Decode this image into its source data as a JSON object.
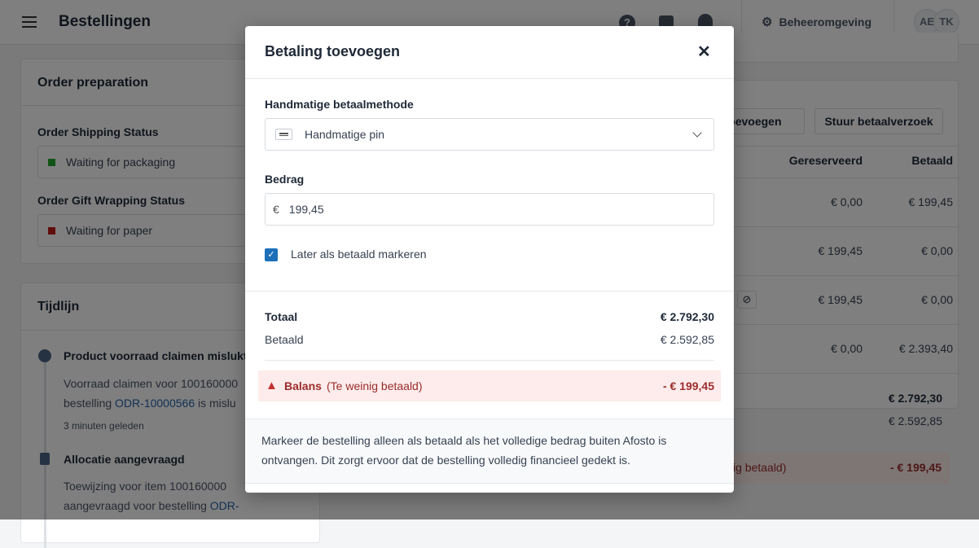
{
  "header": {
    "title": "Bestellingen",
    "admin_label": "Beheeromgeving",
    "avatars": [
      "AE",
      "TK"
    ]
  },
  "order_prep": {
    "title": "Order preparation",
    "shipping_label": "Order Shipping Status",
    "shipping_value": "Waiting for packaging",
    "shipping_color": "#22a82a",
    "gift_label": "Order Gift Wrapping Status",
    "gift_value": "Waiting for paper",
    "gift_color": "#c01818"
  },
  "timeline": {
    "title": "Tijdlijn",
    "items": [
      {
        "title": "Product voorraad claimen mislukt",
        "text1": "Voorraad claimen voor 100160000",
        "text2_pre": "bestelling ",
        "link": "ODR-10000566",
        "text2_post": " is mislu",
        "time": "3 minuten geleden"
      },
      {
        "title": "Allocatie aangevraagd",
        "text1": "Toewijzing voor item 100160000",
        "text2_pre": "aangevraagd voor bestelling ",
        "link": "ODR-"
      }
    ]
  },
  "payments": {
    "add_button": "toevoegen",
    "request_button": "Stuur betaalverzoek",
    "col_reserved": "Gereserveerd",
    "col_paid": "Betaald",
    "rows": [
      {
        "reserved": "€ 0,00",
        "paid": "€ 199,45"
      },
      {
        "reserved": "€ 199,45",
        "paid": "€ 0,00"
      },
      {
        "reserved": "€ 199,45",
        "paid": "€ 0,00"
      },
      {
        "reserved": "€ 0,00",
        "paid": "€ 2.393,40"
      }
    ],
    "total": "€ 2.792,30",
    "paid_total": "€ 2.592,85",
    "balance_note": "ig betaald)",
    "balance": "- € 199,45"
  },
  "modal": {
    "title": "Betaling toevoegen",
    "method_label": "Handmatige betaalmethode",
    "method_value": "Handmatige pin",
    "amount_label": "Bedrag",
    "currency": "€",
    "amount_value": "199,45",
    "checkbox_label": "Later als betaald markeren",
    "checkbox_checked": true,
    "total_label": "Totaal",
    "total_value": "€ 2.792,30",
    "paid_label": "Betaald",
    "paid_value": "€ 2.592,85",
    "balance_label": "Balans",
    "balance_note": "(Te weinig betaald)",
    "balance_value": "- € 199,45",
    "footer_text": "Markeer de bestelling alleen als betaald als het volledige bedrag buiten Afosto is ontvangen. Dit zorgt ervoor dat de bestelling volledig financieel gedekt is."
  }
}
